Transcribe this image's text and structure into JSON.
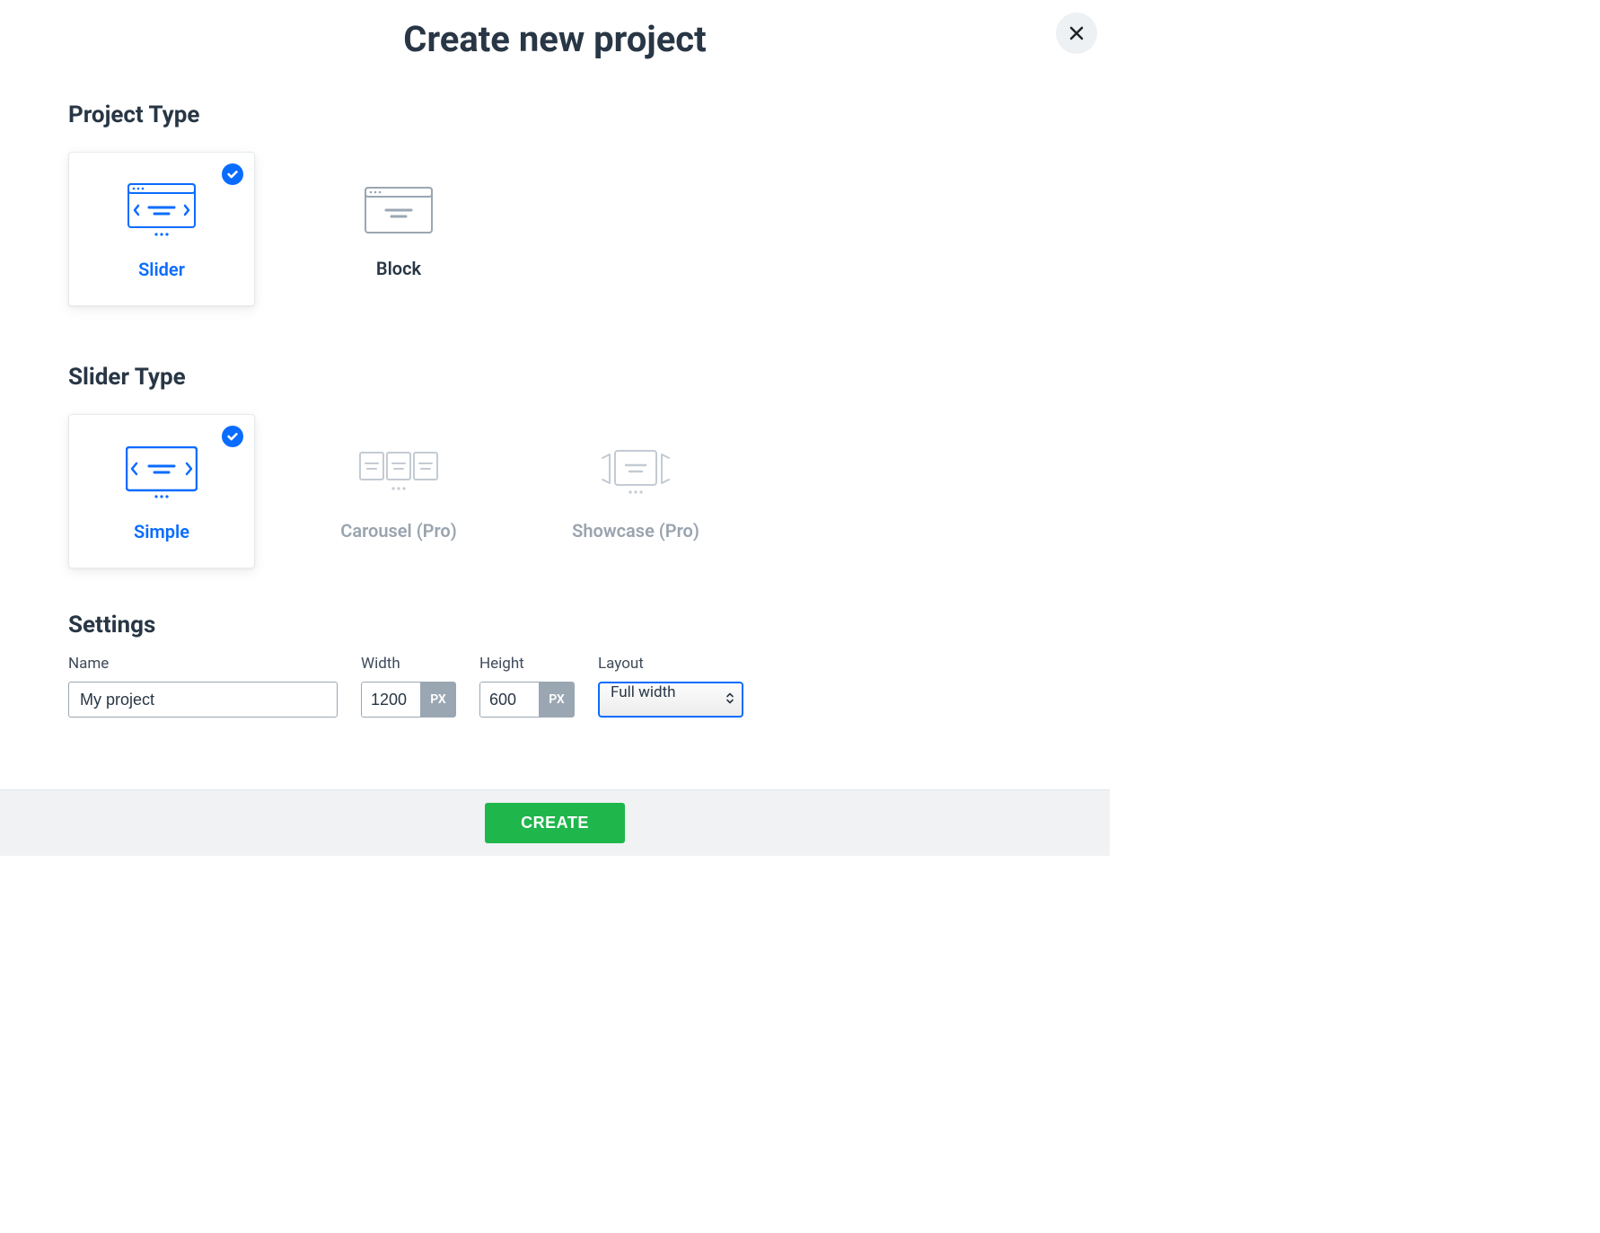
{
  "modal": {
    "title": "Create new project"
  },
  "projectType": {
    "sectionTitle": "Project Type",
    "options": [
      {
        "label": "Slider"
      },
      {
        "label": "Block"
      }
    ]
  },
  "sliderType": {
    "sectionTitle": "Slider Type",
    "options": [
      {
        "label": "Simple"
      },
      {
        "label": "Carousel (Pro)"
      },
      {
        "label": "Showcase (Pro)"
      }
    ]
  },
  "settings": {
    "sectionTitle": "Settings",
    "nameLabel": "Name",
    "nameValue": "My project",
    "widthLabel": "Width",
    "widthValue": "1200",
    "widthUnit": "PX",
    "heightLabel": "Height",
    "heightValue": "600",
    "heightUnit": "PX",
    "layoutLabel": "Layout",
    "layoutValue": "Full width"
  },
  "actions": {
    "createLabel": "CREATE"
  }
}
